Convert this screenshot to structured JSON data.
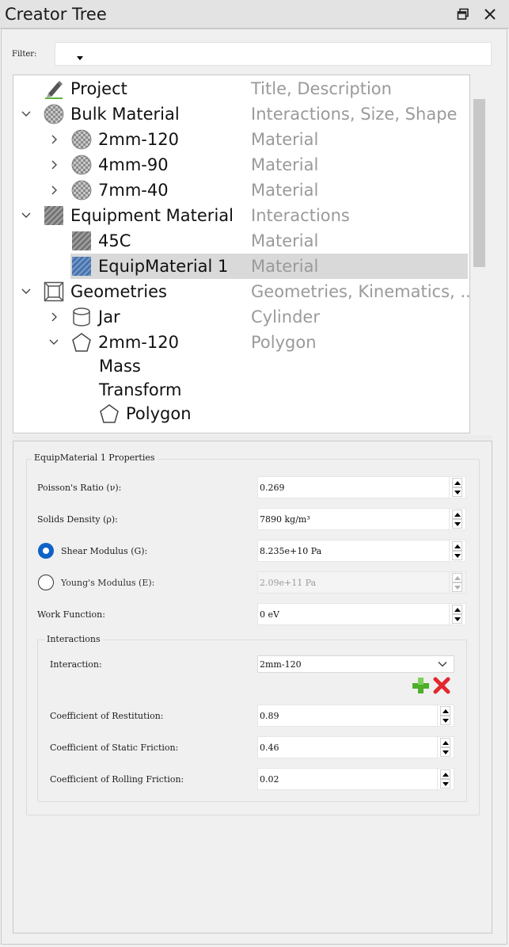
{
  "window": {
    "title": "Creator Tree",
    "float_icon": "float-window-icon",
    "close_icon": "close-icon"
  },
  "filter": {
    "label": "Filter:",
    "value": ""
  },
  "tree": {
    "rows": [
      {
        "name": "Project",
        "desc": "Title, Description",
        "icon": "pencil-icon",
        "chevron": "none"
      },
      {
        "name": "Bulk Material",
        "desc": "Interactions, Size, Shape",
        "icon": "checker-sphere-icon",
        "chevron": "expanded"
      },
      {
        "name": "2mm-120",
        "desc": "Material",
        "icon": "checker-sphere-icon",
        "chevron": "collapsed"
      },
      {
        "name": "4mm-90",
        "desc": "Material",
        "icon": "checker-sphere-icon",
        "chevron": "collapsed"
      },
      {
        "name": "7mm-40",
        "desc": "Material",
        "icon": "checker-sphere-icon",
        "chevron": "collapsed"
      },
      {
        "name": "Equipment Material",
        "desc": "Interactions",
        "icon": "hatched-square-icon",
        "chevron": "expanded"
      },
      {
        "name": "45C",
        "desc": "Material",
        "icon": "hatched-square-icon",
        "chevron": "none"
      },
      {
        "name": "EquipMaterial 1",
        "desc": "Material",
        "icon": "hatched-square-blue-icon",
        "chevron": "none",
        "selected": true
      },
      {
        "name": "Geometries",
        "desc": "Geometries, Kinematics, ...",
        "icon": "geometry-box-icon",
        "chevron": "expanded"
      },
      {
        "name": "Jar",
        "desc": "Cylinder",
        "icon": "cylinder-icon",
        "chevron": "collapsed"
      },
      {
        "name": "2mm-120",
        "desc": "Polygon",
        "icon": "pentagon-icon",
        "chevron": "expanded"
      },
      {
        "name": "Mass",
        "desc": "",
        "icon": "",
        "chevron": "none"
      },
      {
        "name": "Transform",
        "desc": "",
        "icon": "",
        "chevron": "none"
      },
      {
        "name": "Polygon",
        "desc": "",
        "icon": "pentagon-icon",
        "chevron": "none"
      }
    ]
  },
  "props": {
    "group_title": "EquipMaterial 1 Properties",
    "poisson": {
      "label": "Poisson's Ratio (ν):",
      "value": "0.269"
    },
    "density": {
      "label": "Solids Density (ρ):",
      "value": "7890 kg/m³"
    },
    "shear": {
      "label": "Shear Modulus (G):",
      "value": "8.235e+10 Pa",
      "checked": true
    },
    "young": {
      "label": "Young's Modulus (E):",
      "value": "2.09e+11 Pa",
      "checked": false
    },
    "work": {
      "label": "Work Function:",
      "value": "0 eV"
    },
    "interactions": {
      "title": "Interactions",
      "interaction_label": "Interaction:",
      "interaction_value": "2mm-120",
      "add_icon": "add-icon",
      "remove_icon": "remove-icon",
      "restitution": {
        "label": "Coefficient of Restitution:",
        "value": "0.89"
      },
      "static_friction": {
        "label": "Coefficient of Static Friction:",
        "value": "0.46"
      },
      "rolling_friction": {
        "label": "Coefficient of Rolling Friction:",
        "value": "0.02"
      }
    }
  },
  "colors": {
    "accent": "#0f62c8",
    "selection": "#d9d9d9",
    "add_green": "#4caf28",
    "remove_red": "#e0282e"
  }
}
